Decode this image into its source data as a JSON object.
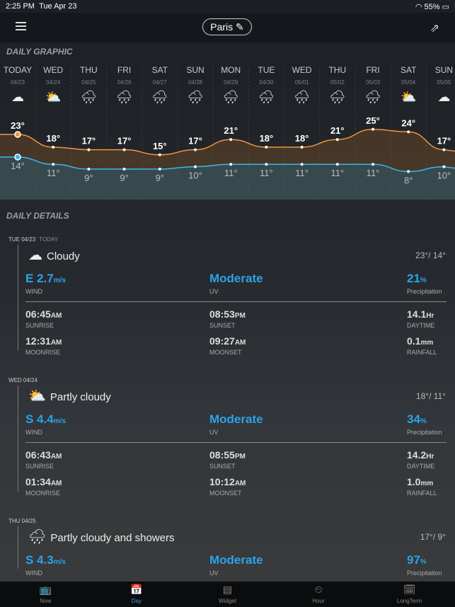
{
  "status": {
    "time": "2:25 PM",
    "date": "Tue Apr 23",
    "battery": "55%"
  },
  "header": {
    "city": "Paris"
  },
  "graphic": {
    "title": "DAILY GRAPHIC",
    "days": [
      {
        "day": "TODAY",
        "date": "04/23",
        "icon": "cloudy",
        "high": 23,
        "low": 14
      },
      {
        "day": "WED",
        "date": "04/24",
        "icon": "partly-cloudy",
        "high": 18,
        "low": 11
      },
      {
        "day": "THU",
        "date": "04/25",
        "icon": "showers",
        "high": 17,
        "low": 9
      },
      {
        "day": "FRI",
        "date": "04/26",
        "icon": "showers",
        "high": 17,
        "low": 9
      },
      {
        "day": "SAT",
        "date": "04/27",
        "icon": "showers",
        "high": 15,
        "low": 9
      },
      {
        "day": "SUN",
        "date": "04/28",
        "icon": "showers",
        "high": 17,
        "low": 10
      },
      {
        "day": "MON",
        "date": "04/29",
        "icon": "showers",
        "high": 21,
        "low": 11
      },
      {
        "day": "TUE",
        "date": "04/30",
        "icon": "showers",
        "high": 18,
        "low": 11
      },
      {
        "day": "WED",
        "date": "05/01",
        "icon": "showers",
        "high": 18,
        "low": 11
      },
      {
        "day": "THU",
        "date": "05/02",
        "icon": "showers",
        "high": 21,
        "low": 11
      },
      {
        "day": "FRI",
        "date": "05/03",
        "icon": "showers",
        "high": 25,
        "low": 11
      },
      {
        "day": "SAT",
        "date": "05/04",
        "icon": "partly-cloudy",
        "high": 24,
        "low": 8
      },
      {
        "day": "SUN",
        "date": "05/05",
        "icon": "cloudy",
        "high": 17,
        "low": 10
      }
    ],
    "colors": {
      "high": "#f0953a",
      "low": "#3ab8e8"
    }
  },
  "details": {
    "title": "DAILY DETAILS",
    "days": [
      {
        "date": "TUE 04/23",
        "tag": "TODAY",
        "icon": "cloudy",
        "condition": "Cloudy",
        "hilo": "23°/ 14°",
        "wind": "E 2.7",
        "wind_unit": "m/s",
        "wind_label": "WIND",
        "uv": "Moderate",
        "uv_label": "UV",
        "precip": "21",
        "precip_unit": "%",
        "precip_label": "Precipitation",
        "sunrise": "06:45",
        "sunrise_ampm": "AM",
        "sunrise_label": "SUNRISE",
        "sunset": "08:53",
        "sunset_ampm": "PM",
        "sunset_label": "SUNSET",
        "daytime": "14.1",
        "daytime_unit": "Hr",
        "daytime_label": "DAYTIME",
        "moonrise": "12:31",
        "moonrise_ampm": "AM",
        "moonrise_label": "MOONRISE",
        "moonset": "09:27",
        "moonset_ampm": "AM",
        "moonset_label": "MOONSET",
        "rain": "0.1",
        "rain_unit": "mm",
        "rain_label": "RAINFALL"
      },
      {
        "date": "WED 04/24",
        "tag": "",
        "icon": "partly-cloudy",
        "condition": "Partly cloudy",
        "hilo": "18°/ 11°",
        "wind": "S 4.4",
        "wind_unit": "m/s",
        "wind_label": "WIND",
        "uv": "Moderate",
        "uv_label": "UV",
        "precip": "34",
        "precip_unit": "%",
        "precip_label": "Precipitation",
        "sunrise": "06:43",
        "sunrise_ampm": "AM",
        "sunrise_label": "SUNRISE",
        "sunset": "08:55",
        "sunset_ampm": "PM",
        "sunset_label": "SUNSET",
        "daytime": "14.2",
        "daytime_unit": "Hr",
        "daytime_label": "DAYTIME",
        "moonrise": "01:34",
        "moonrise_ampm": "AM",
        "moonrise_label": "MOONRISE",
        "moonset": "10:12",
        "moonset_ampm": "AM",
        "moonset_label": "MOONSET",
        "rain": "1.0",
        "rain_unit": "mm",
        "rain_label": "RAINFALL"
      },
      {
        "date": "THU 04/25",
        "tag": "",
        "icon": "showers",
        "condition": "Partly cloudy and showers",
        "hilo": "17°/ 9°",
        "wind": "S 4.3",
        "wind_unit": "m/s",
        "wind_label": "WIND",
        "uv": "Moderate",
        "uv_label": "UV",
        "precip": "97",
        "precip_unit": "%",
        "precip_label": "Precipitation"
      }
    ]
  },
  "tabs": [
    {
      "label": "Now",
      "icon": "tv-icon"
    },
    {
      "label": "Day",
      "icon": "calendar-day-icon",
      "active": true
    },
    {
      "label": "Widget",
      "icon": "widget-icon"
    },
    {
      "label": "Hour",
      "icon": "clock-icon"
    },
    {
      "label": "LongTerm",
      "icon": "calendar-year-icon"
    }
  ]
}
